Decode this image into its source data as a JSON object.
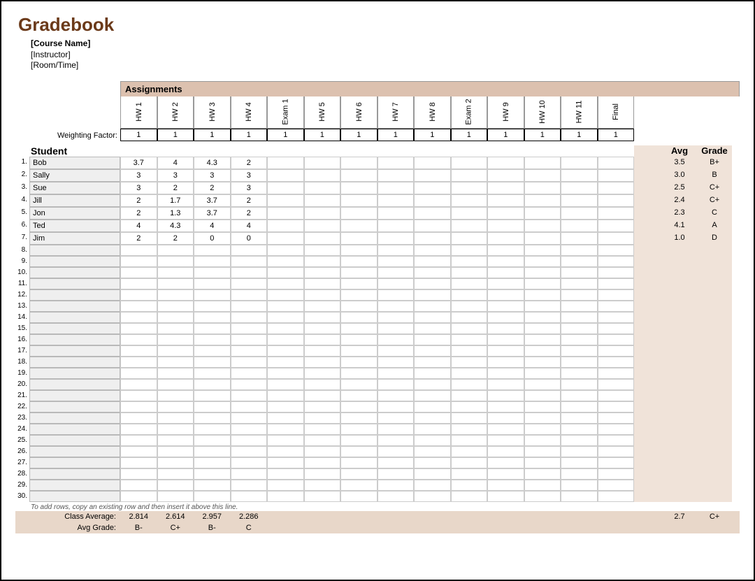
{
  "title": "Gradebook",
  "meta": {
    "course": "[Course Name]",
    "instructor": "[Instructor]",
    "roomtime": "[Room/Time]"
  },
  "labels": {
    "assignments": "Assignments",
    "weighting": "Weighting Factor:",
    "student": "Student",
    "avg": "Avg",
    "grade": "Grade",
    "hint": "To add rows, copy an existing row and then insert it above this line.",
    "class_average": "Class Average:",
    "avg_grade": "Avg Grade:"
  },
  "assignments": [
    "HW 1",
    "HW 2",
    "HW 3",
    "HW 4",
    "Exam 1",
    "HW 5",
    "HW 6",
    "HW 7",
    "HW 8",
    "Exam 2",
    "HW 9",
    "HW 10",
    "HW 11",
    "Final"
  ],
  "weights": [
    "1",
    "1",
    "1",
    "1",
    "1",
    "1",
    "1",
    "1",
    "1",
    "1",
    "1",
    "1",
    "1",
    "1"
  ],
  "row_count": 30,
  "students": [
    {
      "name": "Bob",
      "scores": [
        "3.7",
        "4",
        "4.3",
        "2",
        "",
        "",
        "",
        "",
        "",
        "",
        "",
        "",
        "",
        ""
      ],
      "avg": "3.5",
      "grade": "B+"
    },
    {
      "name": "Sally",
      "scores": [
        "3",
        "3",
        "3",
        "3",
        "",
        "",
        "",
        "",
        "",
        "",
        "",
        "",
        "",
        ""
      ],
      "avg": "3.0",
      "grade": "B"
    },
    {
      "name": "Sue",
      "scores": [
        "3",
        "2",
        "2",
        "3",
        "",
        "",
        "",
        "",
        "",
        "",
        "",
        "",
        "",
        ""
      ],
      "avg": "2.5",
      "grade": "C+"
    },
    {
      "name": "Jill",
      "scores": [
        "2",
        "1.7",
        "3.7",
        "2",
        "",
        "",
        "",
        "",
        "",
        "",
        "",
        "",
        "",
        ""
      ],
      "avg": "2.4",
      "grade": "C+"
    },
    {
      "name": "Jon",
      "scores": [
        "2",
        "1.3",
        "3.7",
        "2",
        "",
        "",
        "",
        "",
        "",
        "",
        "",
        "",
        "",
        ""
      ],
      "avg": "2.3",
      "grade": "C"
    },
    {
      "name": "Ted",
      "scores": [
        "4",
        "4.3",
        "4",
        "4",
        "",
        "",
        "",
        "",
        "",
        "",
        "",
        "",
        "",
        ""
      ],
      "avg": "4.1",
      "grade": "A"
    },
    {
      "name": "Jim",
      "scores": [
        "2",
        "2",
        "0",
        "0",
        "",
        "",
        "",
        "",
        "",
        "",
        "",
        "",
        "",
        ""
      ],
      "avg": "1.0",
      "grade": "D"
    }
  ],
  "class_average": [
    "2.814",
    "2.614",
    "2.957",
    "2.286",
    "",
    "",
    "",
    "",
    "",
    "",
    "",
    "",
    "",
    ""
  ],
  "avg_grade_row": [
    "B-",
    "C+",
    "B-",
    "C",
    "",
    "",
    "",
    "",
    "",
    "",
    "",
    "",
    "",
    ""
  ],
  "overall": {
    "avg": "2.7",
    "grade": "C+"
  }
}
